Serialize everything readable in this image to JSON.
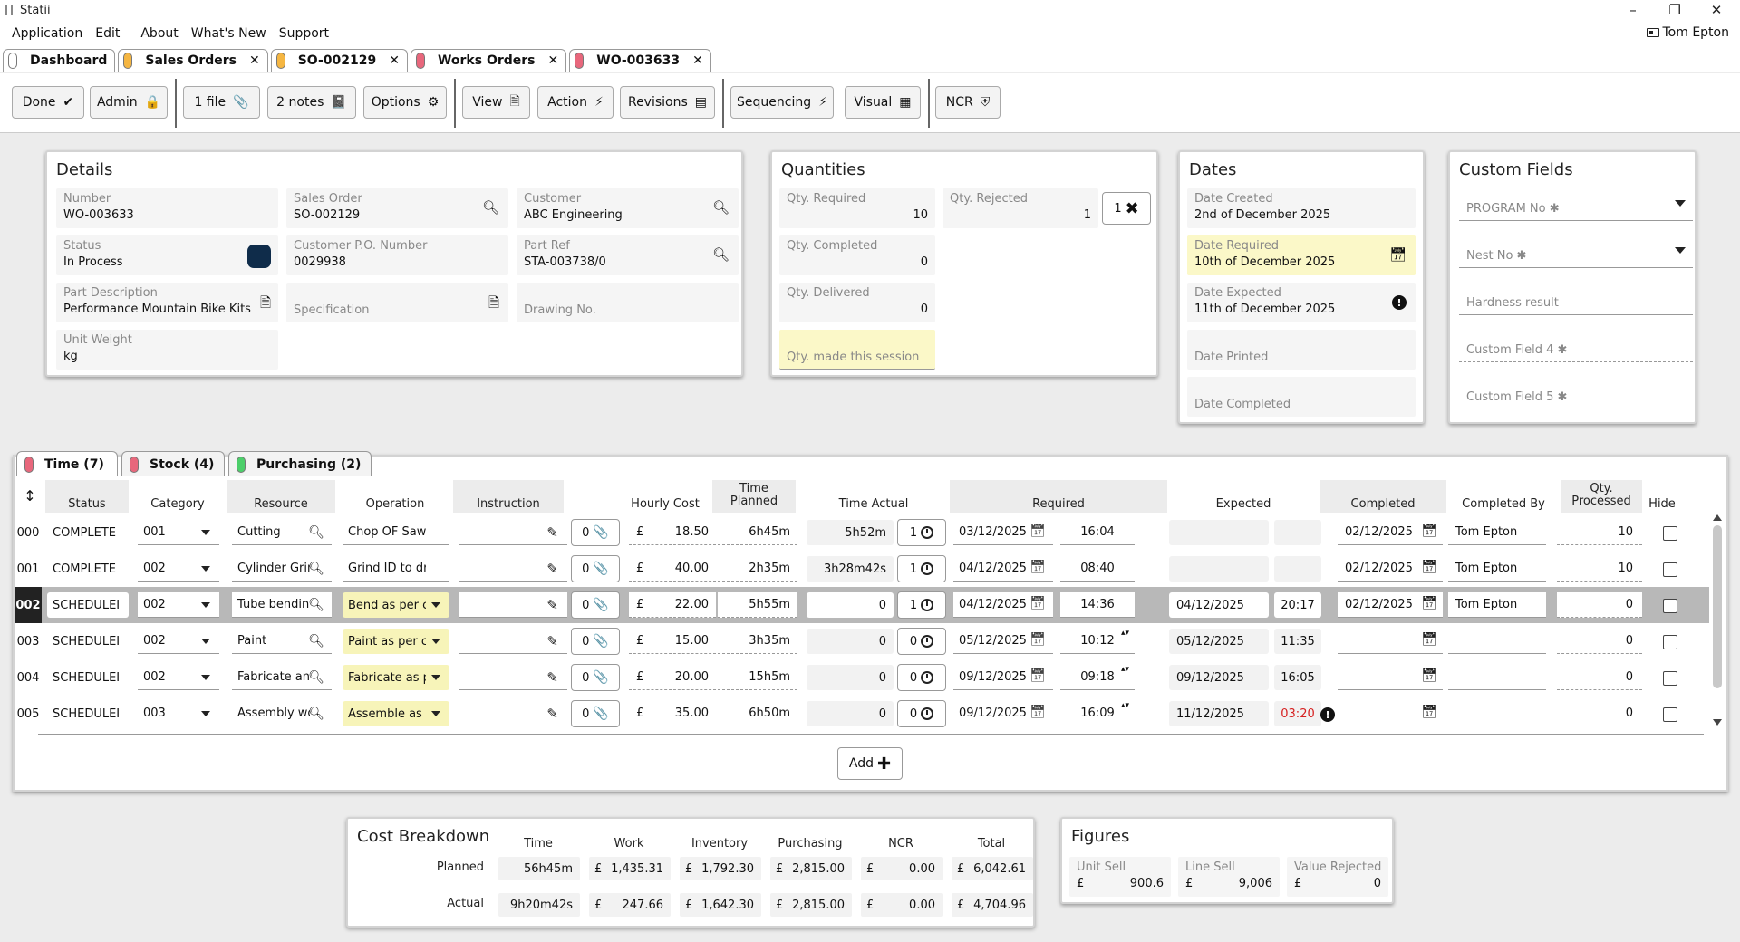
{
  "window": {
    "title": "Statii",
    "minimize": "–",
    "restore": "❐",
    "close": "✕"
  },
  "menu": {
    "items": [
      "Application",
      "Edit",
      "About",
      "What's New",
      "Support"
    ],
    "user": "Tom Epton"
  },
  "doc_tabs": [
    {
      "label": "Dashboard",
      "color": "#ffffff",
      "closable": false
    },
    {
      "label": "Sales Orders",
      "color": "#f5b642",
      "closable": true
    },
    {
      "label": "SO-002129",
      "color": "#f5b642",
      "closable": true
    },
    {
      "label": "Works Orders",
      "color": "#e8677c",
      "closable": true
    },
    {
      "label": "WO-003633",
      "color": "#e8677c",
      "closable": true
    }
  ],
  "toolbar": {
    "done": "Done",
    "admin": "Admin",
    "files": "1 file",
    "notes": "2 notes",
    "options": "Options",
    "view": "View",
    "action": "Action",
    "revisions": "Revisions",
    "sequencing": "Sequencing",
    "visual": "Visual",
    "ncr": "NCR"
  },
  "details": {
    "title": "Details",
    "number_label": "Number",
    "number": "WO-003633",
    "sales_order_label": "Sales Order",
    "sales_order": "SO-002129",
    "customer_label": "Customer",
    "customer": "ABC Engineering",
    "status_label": "Status",
    "status": "In Process",
    "status_color": "#0f2c4a",
    "cust_po_label": "Customer P.O. Number",
    "cust_po": "0029938",
    "part_ref_label": "Part Ref",
    "part_ref": "STA-003738/0",
    "part_desc_label": "Part Description",
    "part_desc": "Performance Mountain Bike Kits",
    "spec_label": "Specification",
    "drawing_label": "Drawing No.",
    "unit_weight_label": "Unit Weight",
    "unit_weight": "kg"
  },
  "quantities": {
    "title": "Quantities",
    "required_label": "Qty. Required",
    "required": "10",
    "rejected_label": "Qty. Rejected",
    "rejected": "1",
    "reject_btn": "1",
    "completed_label": "Qty. Completed",
    "completed": "0",
    "delivered_label": "Qty. Delivered",
    "delivered": "0",
    "session_label": "Qty. made this session"
  },
  "dates": {
    "title": "Dates",
    "created_label": "Date Created",
    "created": "2nd of December 2025",
    "required_label": "Date Required",
    "required": "10th of December 2025",
    "expected_label": "Date Expected",
    "expected": "11th of December 2025",
    "printed_label": "Date Printed",
    "completed_label": "Date Completed"
  },
  "custom_fields": {
    "title": "Custom Fields",
    "fields": [
      "PROGRAM No ✱",
      "Nest No ✱",
      "Hardness result",
      "Custom Field 4 ✱",
      "Custom Field 5 ✱"
    ]
  },
  "grid_tabs": [
    {
      "label": "Time (7)",
      "color": "#e8677c"
    },
    {
      "label": "Stock (4)",
      "color": "#e8677c"
    },
    {
      "label": "Purchasing (2)",
      "color": "#4ccf6a"
    }
  ],
  "grid": {
    "headers": {
      "status": "Status",
      "category": "Category",
      "resource": "Resource",
      "operation": "Operation",
      "instruction": "Instruction",
      "hourly_cost": "Hourly Cost",
      "time_planned_1": "Time",
      "time_planned_2": "Planned",
      "time_actual": "Time Actual",
      "required": "Required",
      "expected": "Expected",
      "completed": "Completed",
      "completed_by": "Completed By",
      "qty_proc_1": "Qty.",
      "qty_proc_2": "Processed",
      "hide": "Hide"
    },
    "currency": "£",
    "rows": [
      {
        "idx": "000",
        "status": "COMPLETE",
        "category": "001",
        "resource": "Cutting",
        "operation": "Chop OF Saw",
        "op_yellow": false,
        "files": "0",
        "hourly": "18.50",
        "planned": "6h45m",
        "actual": "5h52m",
        "timer": "1",
        "req_date": "03/12/2025",
        "req_time": "16:04",
        "exp_date": "",
        "exp_time": "",
        "exp_red": false,
        "comp_date": "02/12/2025",
        "comp_by": "Tom Epton",
        "qty": "10"
      },
      {
        "idx": "001",
        "status": "COMPLETE",
        "category": "002",
        "resource": "Cylinder Grin",
        "operation": "Grind ID to draw",
        "op_yellow": false,
        "files": "0",
        "hourly": "40.00",
        "planned": "2h35m",
        "actual": "3h28m42s",
        "timer": "1",
        "req_date": "04/12/2025",
        "req_time": "08:40",
        "exp_date": "",
        "exp_time": "",
        "exp_red": false,
        "comp_date": "02/12/2025",
        "comp_by": "Tom Epton",
        "qty": "10"
      },
      {
        "idx": "002",
        "status": "SCHEDULEI",
        "category": "002",
        "resource": "Tube bendin",
        "operation": "Bend as per c",
        "op_yellow": true,
        "files": "0",
        "hourly": "22.00",
        "planned": "5h55m",
        "actual": "0",
        "timer": "1",
        "req_date": "04/12/2025",
        "req_time": "14:36",
        "exp_date": "04/12/2025",
        "exp_time": "20:17",
        "exp_red": false,
        "comp_date": "02/12/2025",
        "comp_by": "Tom Epton",
        "qty": "0"
      },
      {
        "idx": "003",
        "status": "SCHEDULEI",
        "category": "002",
        "resource": "Paint",
        "operation": "Paint as per c",
        "op_yellow": true,
        "files": "0",
        "hourly": "15.00",
        "planned": "3h35m",
        "actual": "0",
        "timer": "0",
        "req_date": "05/12/2025",
        "req_time": "10:12",
        "exp_date": "05/12/2025",
        "exp_time": "11:35",
        "exp_red": false,
        "comp_date": "",
        "comp_by": "",
        "qty": "0"
      },
      {
        "idx": "004",
        "status": "SCHEDULEI",
        "category": "002",
        "resource": "Fabricate an",
        "operation": "Fabricate as p",
        "op_yellow": true,
        "files": "0",
        "hourly": "20.00",
        "planned": "15h5m",
        "actual": "0",
        "timer": "0",
        "req_date": "09/12/2025",
        "req_time": "09:18",
        "exp_date": "09/12/2025",
        "exp_time": "16:05",
        "exp_red": false,
        "comp_date": "",
        "comp_by": "",
        "qty": "0"
      },
      {
        "idx": "005",
        "status": "SCHEDULEI",
        "category": "003",
        "resource": "Assembly wc",
        "operation": "Assemble as",
        "op_yellow": true,
        "files": "0",
        "hourly": "35.00",
        "planned": "6h50m",
        "actual": "0",
        "timer": "0",
        "req_date": "09/12/2025",
        "req_time": "16:09",
        "exp_date": "11/12/2025",
        "exp_time": "03:20",
        "exp_red": true,
        "comp_date": "",
        "comp_by": "",
        "qty": "0"
      }
    ],
    "add_label": "Add"
  },
  "cost_breakdown": {
    "title": "Cost Breakdown",
    "headers": [
      "Time",
      "Work",
      "Inventory",
      "Purchasing",
      "NCR",
      "Total"
    ],
    "planned_label": "Planned",
    "actual_label": "Actual",
    "planned": {
      "time": "56h45m",
      "work": "1,435.31",
      "inventory": "1,792.30",
      "purchasing": "2,815.00",
      "ncr": "0.00",
      "total": "6,042.61"
    },
    "actual": {
      "time": "9h20m42s",
      "work": "247.66",
      "inventory": "1,642.30",
      "purchasing": "2,815.00",
      "ncr": "0.00",
      "total": "4,704.96"
    }
  },
  "figures": {
    "title": "Figures",
    "unit_sell_label": "Unit Sell",
    "unit_sell": "900.6",
    "line_sell_label": "Line Sell",
    "line_sell": "9,006",
    "value_rejected_label": "Value Rejected",
    "value_rejected": "0"
  }
}
